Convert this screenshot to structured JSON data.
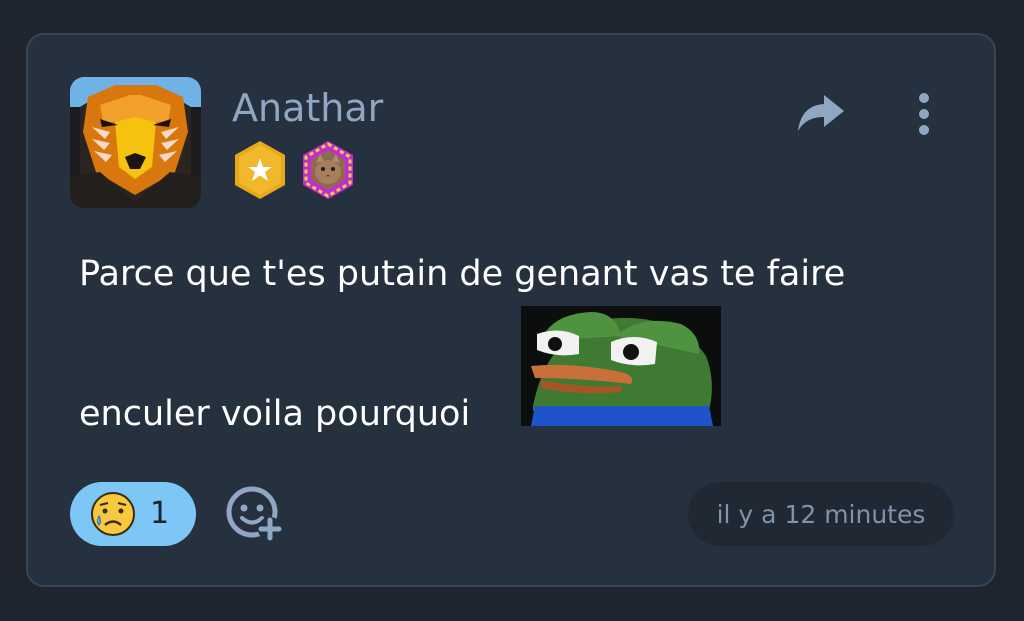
{
  "post": {
    "author": "Anathar",
    "message_line1": "Parce que t'es putain de genant vas te faire",
    "message_line2": "enculer voila pourquoi",
    "timestamp": "il y a 12 minutes"
  },
  "icons": {
    "avatar": "bear-mask-avatar",
    "badges": [
      "gold-star-hexagon-badge",
      "cat-hexagon-badge"
    ],
    "share": "share-arrow-icon",
    "more": "vertical-dots-icon",
    "emote": "pepe-frog-emote",
    "reaction_emoji": "sad-tear-emoji",
    "add_reaction": "add-emoji-icon"
  },
  "reactions": [
    {
      "emoji": "sad-tear-emoji",
      "count": "1"
    }
  ],
  "colors": {
    "background": "#1f252f",
    "card": "#263140",
    "card_border": "#3a4454",
    "username": "#8fa7c2",
    "reaction_pill": "#7cc7f5",
    "timestamp_bg": "#1f2833",
    "timestamp_text": "#7f93aa"
  }
}
